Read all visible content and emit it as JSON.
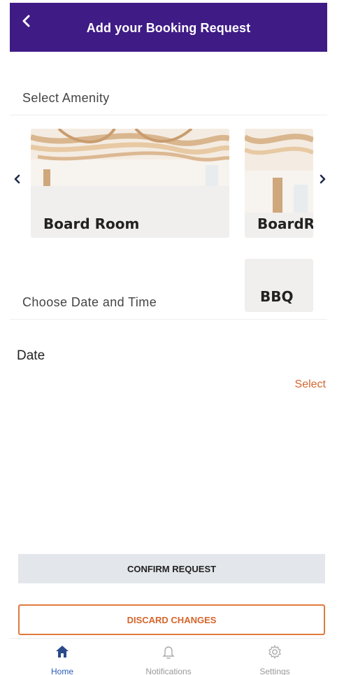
{
  "header": {
    "title": "Add your Booking Request",
    "back_icon": "chevron-left-icon"
  },
  "sections": {
    "amenity": "Select Amenity",
    "datetime": "Choose Date and Time"
  },
  "amenities": [
    {
      "name": "Board Room"
    },
    {
      "name": "BoardR"
    },
    {
      "name": "BBQ"
    }
  ],
  "date": {
    "label": "Date",
    "action": "Select"
  },
  "actions": {
    "confirm": "CONFIRM REQUEST",
    "discard": "DISCARD CHANGES"
  },
  "tabs": [
    {
      "label": "Home",
      "icon": "home-icon",
      "active": true
    },
    {
      "label": "Notifications",
      "icon": "bell-icon",
      "active": false
    },
    {
      "label": "Settings",
      "icon": "gear-icon",
      "active": false
    }
  ],
  "colors": {
    "header": "#3f1b86",
    "accent": "#d4662c",
    "active_tab": "#2a5bb8"
  }
}
